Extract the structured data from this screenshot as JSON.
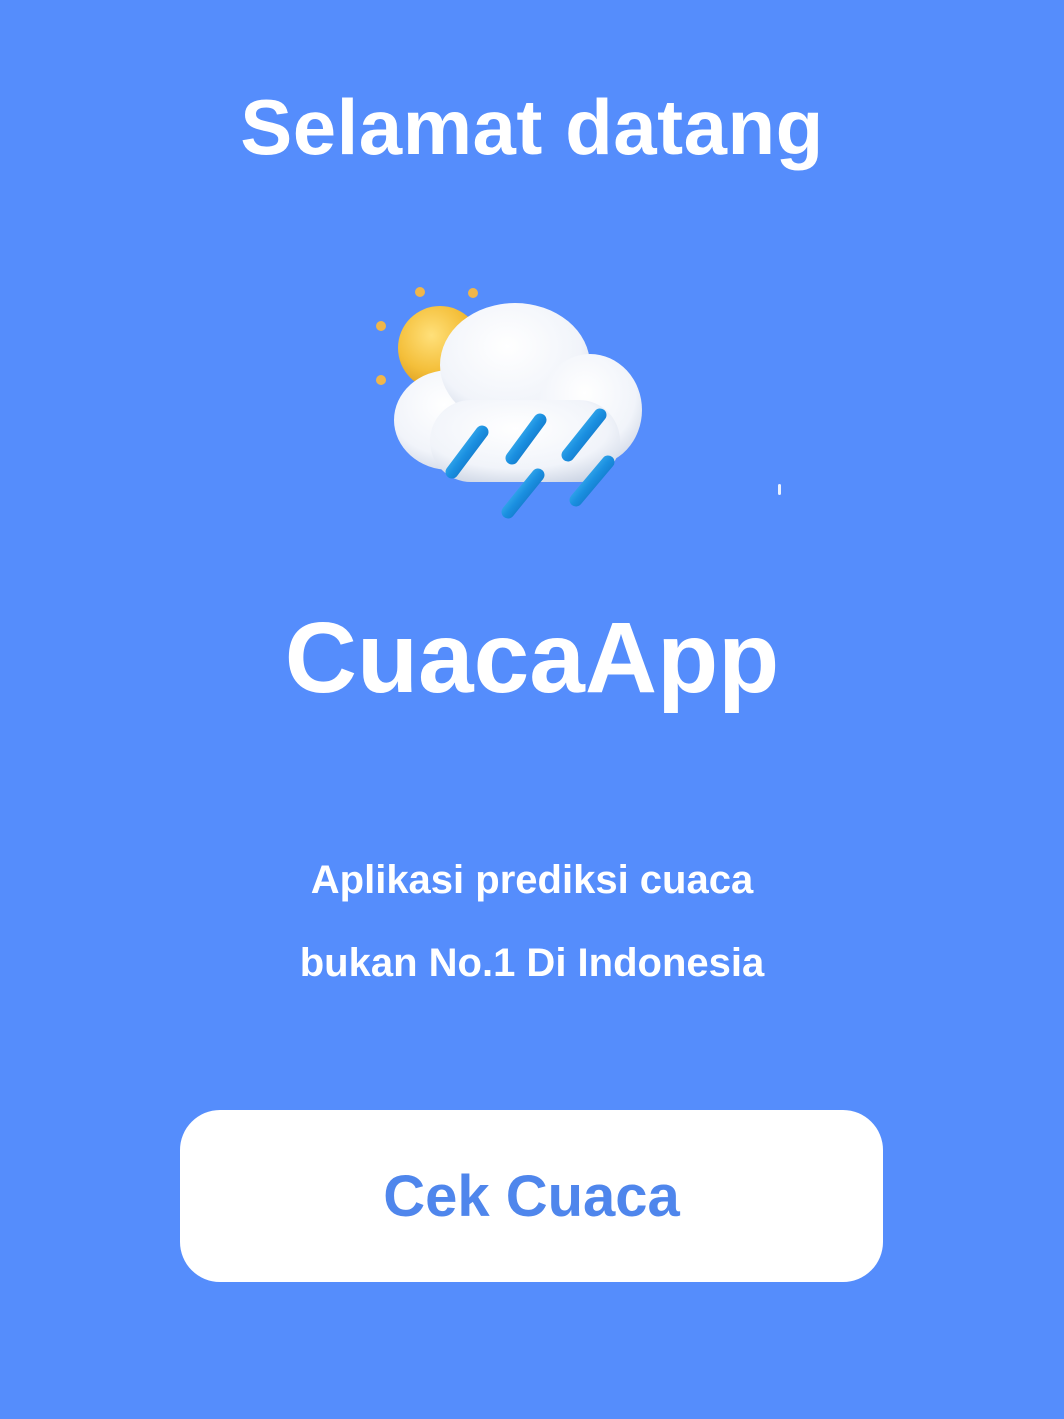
{
  "screen": {
    "welcome_title": "Selamat datang",
    "app_name": "CuacaApp",
    "tagline_line1": "Aplikasi prediksi cuaca",
    "tagline_line2": "bukan No.1 Di Indonesia",
    "cta_label": "Cek Cuaca"
  },
  "illustration": {
    "icon": "sun-behind-rain-cloud-icon"
  },
  "colors": {
    "background": "#558dfc",
    "text": "#ffffff",
    "button_bg": "#ffffff",
    "button_text": "#4f86ec"
  }
}
